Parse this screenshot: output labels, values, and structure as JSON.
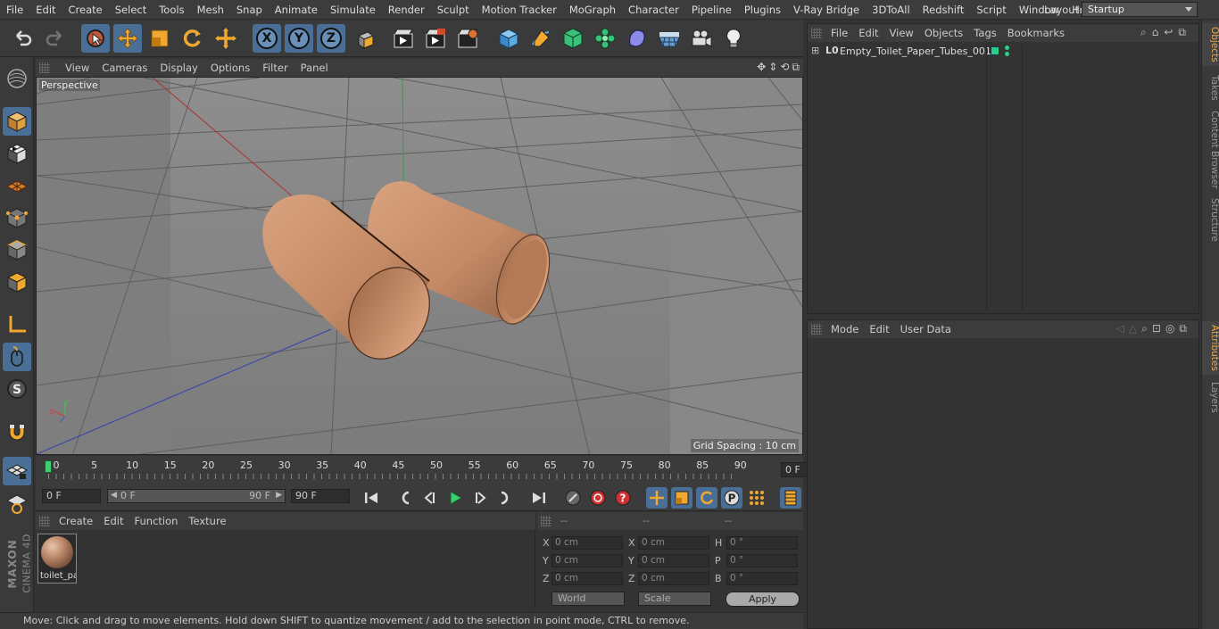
{
  "menubar": {
    "items": [
      "File",
      "Edit",
      "Create",
      "Select",
      "Tools",
      "Mesh",
      "Snap",
      "Animate",
      "Simulate",
      "Render",
      "Sculpt",
      "Motion Tracker",
      "MoGraph",
      "Character",
      "Pipeline",
      "Plugins",
      "V-Ray Bridge",
      "3DToAll",
      "Redshift",
      "Script",
      "Window",
      "Help"
    ],
    "layout_label": "Layout:",
    "layout_value": "Startup"
  },
  "toolbar": {
    "icons": [
      "undo-icon",
      "redo-icon",
      "live-selection-icon",
      "move-icon",
      "scale-icon",
      "rotate-icon",
      "recent-tool-icon",
      "x-axis-icon",
      "y-axis-icon",
      "z-axis-icon",
      "coordinate-system-icon",
      "render-view-icon",
      "render-picture-viewer-icon",
      "render-settings-icon",
      "cube-icon",
      "pen-icon",
      "subdivision-icon",
      "cloner-icon",
      "deformer-icon",
      "floor-icon",
      "camera-icon",
      "light-icon"
    ],
    "axis_x": "X",
    "axis_y": "Y",
    "axis_z": "Z"
  },
  "viewport": {
    "menu": [
      "View",
      "Cameras",
      "Display",
      "Options",
      "Filter",
      "Panel"
    ],
    "label": "Perspective",
    "grid_spacing": "Grid Spacing : 10 cm"
  },
  "timeline": {
    "ticks": [
      "0",
      "5",
      "10",
      "15",
      "20",
      "25",
      "30",
      "35",
      "40",
      "45",
      "50",
      "55",
      "60",
      "65",
      "70",
      "75",
      "80",
      "85",
      "90"
    ],
    "current_frame": "0 F"
  },
  "playback": {
    "start": "0 F",
    "range_start": "0 F",
    "range_end": "90 F",
    "end": "90 F"
  },
  "materials": {
    "menu": [
      "Create",
      "Edit",
      "Function",
      "Texture"
    ],
    "items": [
      {
        "name": "toilet_pa"
      }
    ]
  },
  "coordinates": {
    "headers": [
      "--",
      "--",
      "--"
    ],
    "rows": [
      {
        "l1": "X",
        "v1": "0 cm",
        "l2": "X",
        "v2": "0 cm",
        "l3": "H",
        "v3": "0 °"
      },
      {
        "l1": "Y",
        "v1": "0 cm",
        "l2": "Y",
        "v2": "0 cm",
        "l3": "P",
        "v3": "0 °"
      },
      {
        "l1": "Z",
        "v1": "0 cm",
        "l2": "Z",
        "v2": "0 cm",
        "l3": "B",
        "v3": "0 °"
      }
    ],
    "mode": "World",
    "scale": "Scale",
    "apply": "Apply"
  },
  "status": "Move: Click and drag to move elements. Hold down SHIFT to quantize movement / add to the selection in point mode, CTRL to remove.",
  "objects": {
    "menu": [
      "File",
      "Edit",
      "View",
      "Objects",
      "Tags",
      "Bookmarks"
    ],
    "items": [
      {
        "name": "Empty_Toilet_Paper_Tubes_001"
      }
    ]
  },
  "attributes": {
    "menu": [
      "Mode",
      "Edit",
      "User Data"
    ]
  },
  "right_tabs": [
    "Objects",
    "Takes",
    "Content Browser",
    "Structure",
    "Attributes",
    "Layers"
  ],
  "brand": {
    "line1": "MAXON",
    "line2": "CINEMA 4D"
  },
  "colors": {
    "selected": "#4a6f96",
    "accent": "#e8a850",
    "tube": "#c8906c",
    "obj_tag": "#2ecc8a"
  }
}
